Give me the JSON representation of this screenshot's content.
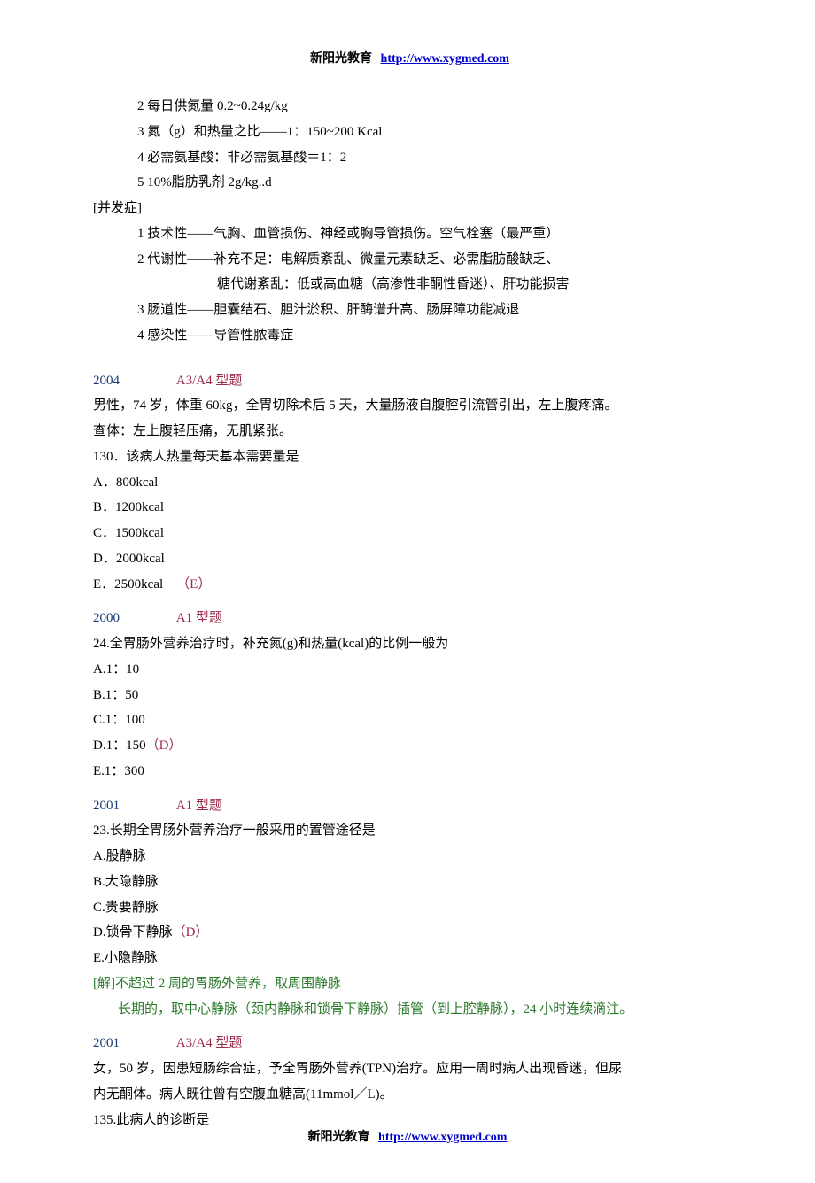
{
  "header": {
    "org": "新阳光教育",
    "url": "http://www.xygmed.com"
  },
  "intro": {
    "items": [
      "2  每日供氮量 0.2~0.24g/kg",
      "3  氮（g）和热量之比——1：150~200 Kcal",
      "4  必需氨基酸：非必需氨基酸＝1：2",
      "5 10%脂肪乳剂 2g/kg..d"
    ]
  },
  "complications": {
    "label": "[并发症]",
    "items": [
      "1  技术性——气胸、血管损伤、神经或胸导管损伤。空气栓塞（最严重）",
      "2  代谢性——补充不足：电解质紊乱、微量元素缺乏、必需脂肪酸缺乏、",
      "糖代谢紊乱：低或高血糖（高渗性非酮性昏迷）、肝功能损害",
      "3  肠道性——胆囊结石、胆汁淤积、肝酶谱升高、肠屏障功能减退",
      "4  感染性——导管性脓毒症"
    ]
  },
  "q1": {
    "year": "2004",
    "type": "A3/A4 型题",
    "stem1": "男性，74 岁，体重 60kg，全胃切除术后 5 天，大量肠液自腹腔引流管引出，左上腹疼痛。",
    "stem2": "查体：左上腹轻压痛，无肌紧张。",
    "q": "130．该病人热量每天基本需要量是",
    "opts": [
      "A．800kcal",
      "B．1200kcal",
      "C．1500kcal",
      "D．2000kcal"
    ],
    "optE": "E．2500kcal",
    "ans": "（E）"
  },
  "q2": {
    "year": "2000",
    "type": "A1 型题",
    "q": "24.全胃肠外营养治疗时，补充氮(g)和热量(kcal)的比例一般为",
    "opts": [
      "A.1：10",
      "B.1：50",
      "C.1：100"
    ],
    "optD": "D.1：150",
    "ansD": "（D）",
    "optE": "E.1：300"
  },
  "q3": {
    "year": "2001",
    "type": "A1 型题",
    "q": "23.长期全胃肠外营养治疗一般采用的置管途径是",
    "opts": [
      "A.股静脉",
      "B.大隐静脉",
      "C.贵要静脉"
    ],
    "optD": "D.锁骨下静脉",
    "ansD": "（D）",
    "optE": "E.小隐静脉",
    "expl_label": "[解]",
    "expl1": "不超过 2 周的胃肠外营养，取周围静脉",
    "expl2": "长期的，取中心静脉（颈内静脉和锁骨下静脉）插管（到上腔静脉），24 小时连续滴注。"
  },
  "q4": {
    "year": "2001",
    "type": "A3/A4 型题",
    "stem1": "女，50 岁，因患短肠综合症，予全胃肠外营养(TPN)治疗。应用一周时病人出现昏迷，但尿",
    "stem2": "内无酮体。病人既往曾有空腹血糖高(11mmol／L)。",
    "q": "135.此病人的诊断是"
  },
  "footer": {
    "org": "新阳光教育",
    "url": "http://www.xygmed.com"
  }
}
